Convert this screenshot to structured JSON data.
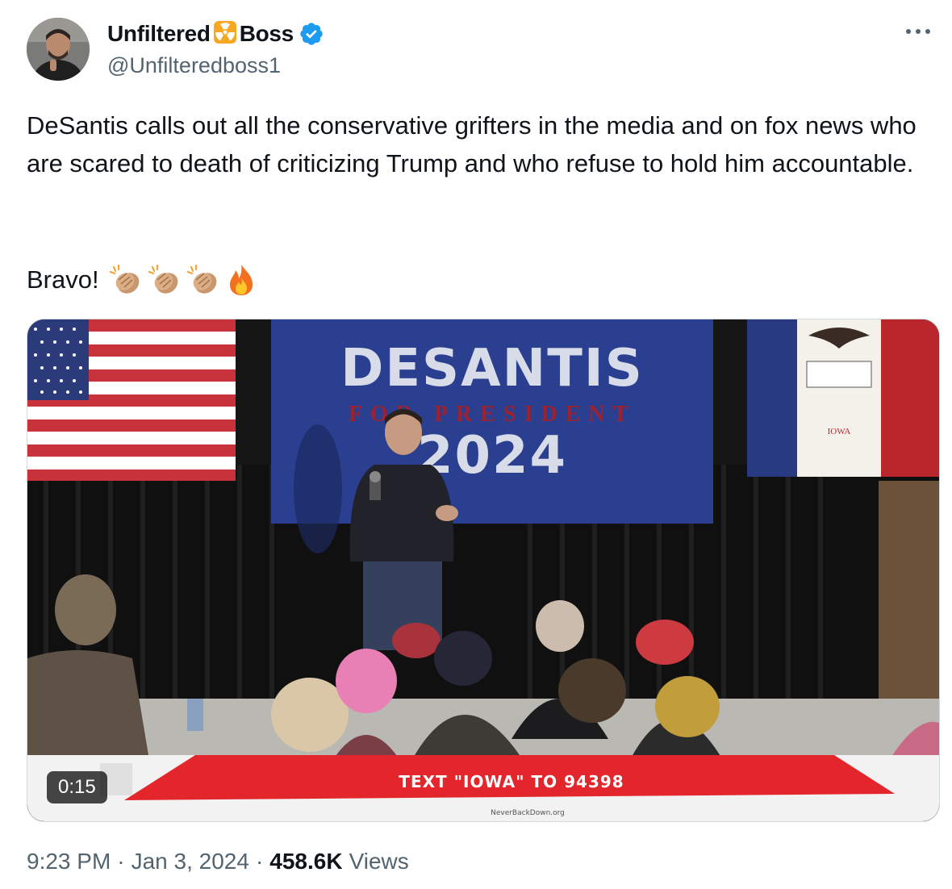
{
  "author": {
    "name_part1": "Unfiltered",
    "name_part2": "Boss",
    "name_emoji": "radioactive-emoji",
    "handle": "@Unfilteredboss1",
    "verified": true,
    "verified_color": "#1d9bf0"
  },
  "tweet": {
    "text": "DeSantis calls out all the conservative grifters in the media and on fox news who are scared to death of criticizing Trump and who refuse to hold him accountable.",
    "bravo": "Bravo!",
    "emojis": [
      "clapping-hands-emoji",
      "clapping-hands-emoji",
      "clapping-hands-emoji",
      "fire-emoji"
    ]
  },
  "media": {
    "type": "video",
    "duration": "0:15",
    "banner_title": "DESANTIS",
    "banner_subtitle": "FOR PRESIDENT",
    "banner_year": "2024",
    "lower_third": "TEXT \"IOWA\" TO 94398",
    "lower_third_url": "NeverBackDown.org",
    "iowa_flag_text": "IOWA"
  },
  "meta": {
    "time": "9:23 PM",
    "date": "Jan 3, 2024",
    "views_count": "458.6K",
    "views_label": "Views"
  },
  "colors": {
    "text_primary": "#0f1419",
    "text_secondary": "#536471",
    "banner_blue": "#2a3f8f",
    "lower_third_red": "#e3262b"
  }
}
